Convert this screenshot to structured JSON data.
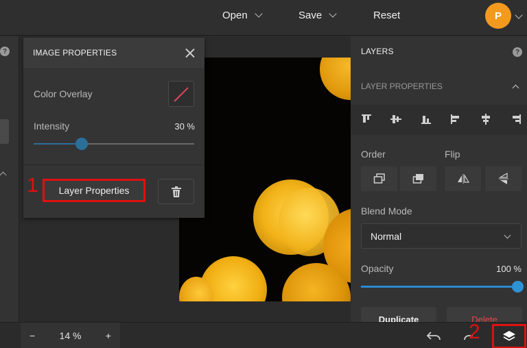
{
  "topbar": {
    "open_label": "Open",
    "save_label": "Save",
    "reset_label": "Reset",
    "avatar_initial": "P"
  },
  "image_properties": {
    "title": "IMAGE PROPERTIES",
    "color_overlay_label": "Color Overlay",
    "intensity_label": "Intensity",
    "intensity_value": "30 %",
    "intensity_level": 0.3,
    "layer_properties_label": "Layer Properties",
    "marker_1": "1"
  },
  "layers_panel": {
    "title": "LAYERS",
    "help_glyph": "?",
    "layer_properties_label": "LAYER PROPERTIES",
    "order_label": "Order",
    "flip_label": "Flip",
    "blend_mode_label": "Blend Mode",
    "blend_mode_value": "Normal",
    "opacity_label": "Opacity",
    "opacity_value": "100 %",
    "opacity_level": 1.0,
    "duplicate_label": "Duplicate",
    "delete_label": "Delete"
  },
  "bottombar": {
    "zoom_minus": "−",
    "zoom_value": "14 %",
    "zoom_plus": "+",
    "marker_2": "2"
  },
  "colors": {
    "accent": "#2c8bd0",
    "avatar": "#f39a1e",
    "delete": "#e5484d",
    "highlight": "#e01010"
  }
}
